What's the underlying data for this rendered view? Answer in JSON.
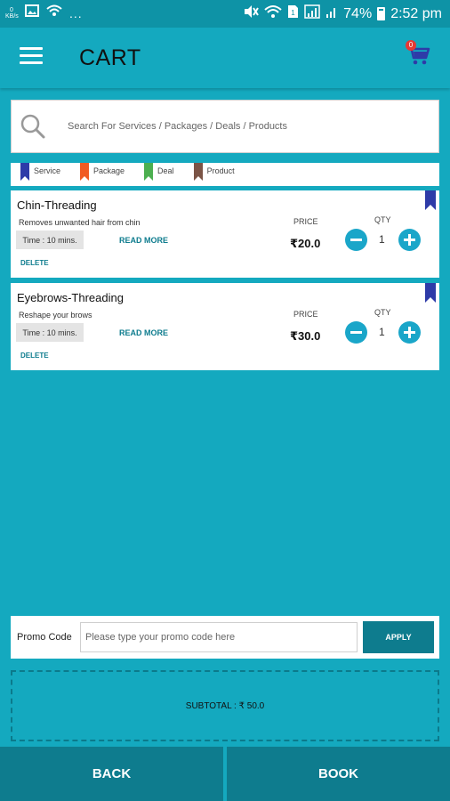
{
  "status_bar": {
    "kb_label": "0\nKB/s",
    "dots": "...",
    "battery": "74%",
    "time": "2:52 pm",
    "icons": [
      "image-icon",
      "wifi-icon",
      "mute-icon",
      "wifi-icon",
      "sim-icon",
      "signal-icon",
      "battery-icon"
    ]
  },
  "header": {
    "title": "CART",
    "cart_badge": "0",
    "icons": [
      "menu-icon",
      "cart-icon"
    ]
  },
  "search": {
    "placeholder": "Search For Services / Packages / Deals / Products",
    "icon": "search-icon"
  },
  "legend": [
    {
      "label": "Service",
      "color": "#2E3BA8"
    },
    {
      "label": "Package",
      "color": "#F15A22"
    },
    {
      "label": "Deal",
      "color": "#4CAF50"
    },
    {
      "label": "Product",
      "color": "#7B5446"
    }
  ],
  "cart_items": [
    {
      "name": "Chin-Threading",
      "description": "Removes unwanted hair from chin",
      "time": "Time : 10 mins.",
      "read_more": "READ MORE",
      "delete": "DELETE",
      "price_label": "PRICE",
      "price": "₹20.0",
      "qty_label": "QTY",
      "qty": "1",
      "type_color": "#2E3BA8"
    },
    {
      "name": "Eyebrows-Threading",
      "description": "Reshape your brows",
      "time": "Time : 10 mins.",
      "read_more": "READ MORE",
      "delete": "DELETE",
      "price_label": "PRICE",
      "price": "₹30.0",
      "qty_label": "QTY",
      "qty": "1",
      "type_color": "#2E3BA8"
    }
  ],
  "promo": {
    "label": "Promo Code",
    "placeholder": "Please type your promo code here",
    "apply_label": "APPLY"
  },
  "subtotal": "SUBTOTAL : ₹ 50.0",
  "footer": {
    "back_label": "BACK",
    "book_label": "BOOK"
  },
  "colors": {
    "primary": "#14A9BF",
    "dark": "#0E7C8E",
    "accent": "#1AA6C9"
  }
}
